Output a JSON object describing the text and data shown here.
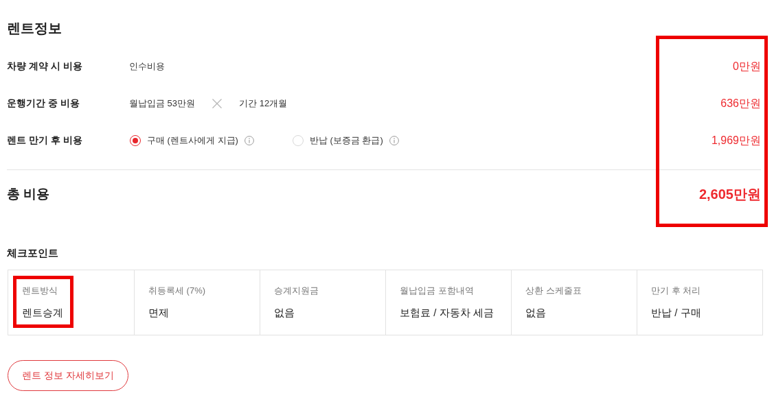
{
  "rent_info": {
    "title": "렌트정보",
    "cost_rows": [
      {
        "label": "차량 계약 시 비용",
        "kind": "text",
        "detail": "인수비용",
        "amount": "0만원"
      },
      {
        "label": "운행기간 중 비용",
        "kind": "product",
        "factors": [
          "월납입금 53만원",
          "기간 12개월"
        ],
        "amount": "636만원"
      },
      {
        "label": "렌트 만기 후 비용",
        "kind": "options",
        "options": [
          {
            "label": "구매 (렌트사에게 지급)",
            "selected": true
          },
          {
            "label": "반납 (보증금 환급)",
            "selected": false
          }
        ],
        "amount": "1,969만원"
      }
    ],
    "total": {
      "label": "총 비용",
      "amount": "2,605만원"
    },
    "amounts_highlighted": true
  },
  "checkpoints": {
    "title": "체크포인트",
    "items": [
      {
        "label": "렌트방식",
        "value": "렌트승계",
        "highlighted": true
      },
      {
        "label": "취등록세 (7%)",
        "value": "면제",
        "highlighted": false
      },
      {
        "label": "승계지원금",
        "value": "없음",
        "highlighted": false
      },
      {
        "label": "월납입금 포함내역",
        "value": "보험료 / 자동차 세금",
        "highlighted": false
      },
      {
        "label": "상환 스케줄표",
        "value": "없음",
        "highlighted": false
      },
      {
        "label": "만기 후 처리",
        "value": "반납 / 구매",
        "highlighted": false
      }
    ]
  },
  "detail_button": "렌트 정보 자세히보기"
}
